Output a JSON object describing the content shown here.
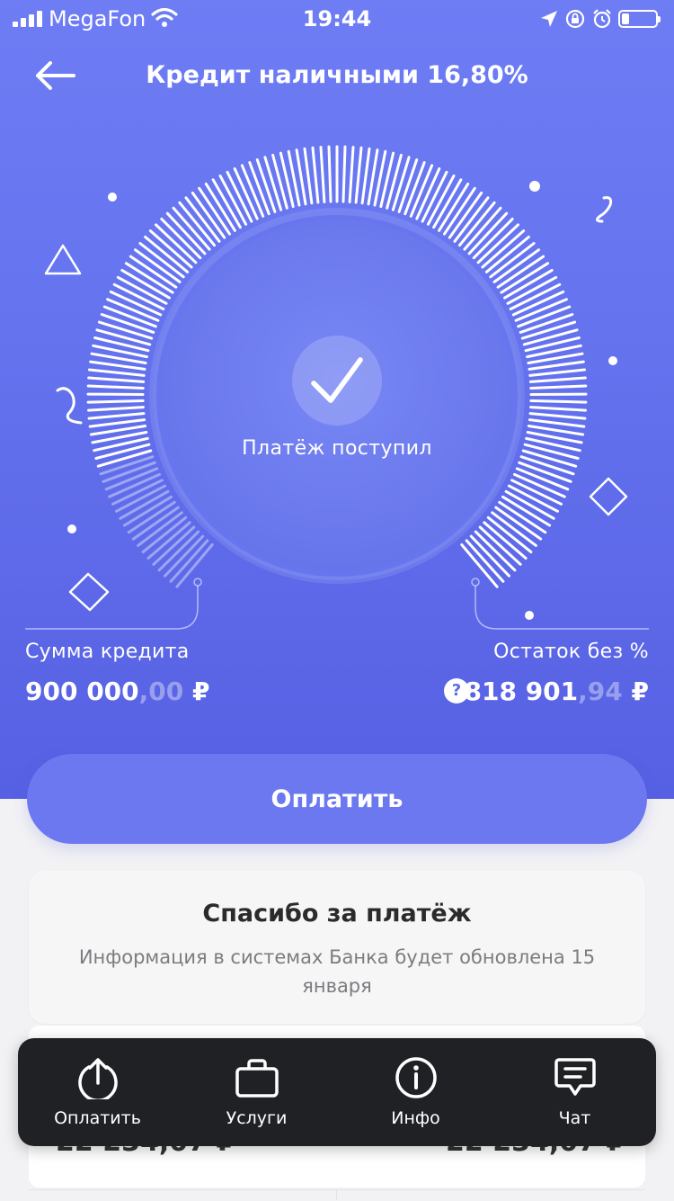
{
  "status_bar": {
    "carrier": "MegaFon",
    "time": "19:44"
  },
  "header": {
    "title": "Кредит наличными 16,80%"
  },
  "payment_status": {
    "text": "Платёж поступил"
  },
  "loan": {
    "amount_label": "Сумма кредита",
    "amount_main": "900 000",
    "amount_frac": ",00",
    "amount_currency": " ₽",
    "remaining_label": "Остаток без %",
    "remaining_main": "818 901",
    "remaining_frac": ",94",
    "remaining_currency": " ₽",
    "help_symbol": "?"
  },
  "pay_button": {
    "label": "Оплатить"
  },
  "notice": {
    "title": "Спасибо за платёж",
    "text": "Информация в системах Банка будет обновлена 15 января"
  },
  "partial_amounts": {
    "left": "22 234,07 ₽",
    "right": "22 234,07 ₽"
  },
  "tabbar": {
    "items": [
      {
        "label": "Оплатить",
        "icon": "pay-icon"
      },
      {
        "label": "Услуги",
        "icon": "briefcase-icon"
      },
      {
        "label": "Инфо",
        "icon": "info-icon"
      },
      {
        "label": "Чат",
        "icon": "chat-icon"
      }
    ]
  },
  "colors": {
    "hero": "#6472ee",
    "tabbar": "#1f2125",
    "card": "#f6f6f7"
  }
}
